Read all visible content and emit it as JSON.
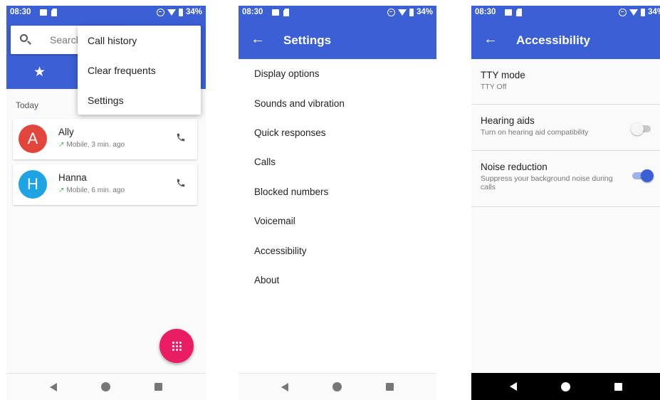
{
  "colors": {
    "primary": "#3b5fd4",
    "accent": "#ea1c63",
    "avatar_a": "#e2453c",
    "avatar_h": "#1ea3e4"
  },
  "status": {
    "time": "08:30",
    "battery": "34%"
  },
  "dialer": {
    "search_placeholder": "Search",
    "menu": [
      "Call history",
      "Clear frequents",
      "Settings"
    ],
    "section": "Today",
    "contacts": [
      {
        "initial": "A",
        "name": "Ally",
        "detail": "Mobile, 3 min. ago"
      },
      {
        "initial": "H",
        "name": "Hanna",
        "detail": "Mobile, 6 min. ago"
      }
    ]
  },
  "settings": {
    "title": "Settings",
    "items": [
      "Display options",
      "Sounds and vibration",
      "Quick responses",
      "Calls",
      "Blocked numbers",
      "Voicemail",
      "Accessibility",
      "About"
    ]
  },
  "accessibility": {
    "title": "Accessibility",
    "tty": {
      "title": "TTY mode",
      "sub": "TTY Off"
    },
    "hearing": {
      "title": "Hearing aids",
      "sub": "Turn on hearing aid compatibility",
      "on": false
    },
    "noise": {
      "title": "Noise reduction",
      "sub": "Suppress your background noise during calls",
      "on": true
    }
  },
  "icons": [
    "search-icon",
    "star-icon",
    "phone-icon",
    "dialpad-icon",
    "back-arrow-icon",
    "nav-back-icon",
    "nav-home-icon",
    "nav-recents-icon"
  ]
}
